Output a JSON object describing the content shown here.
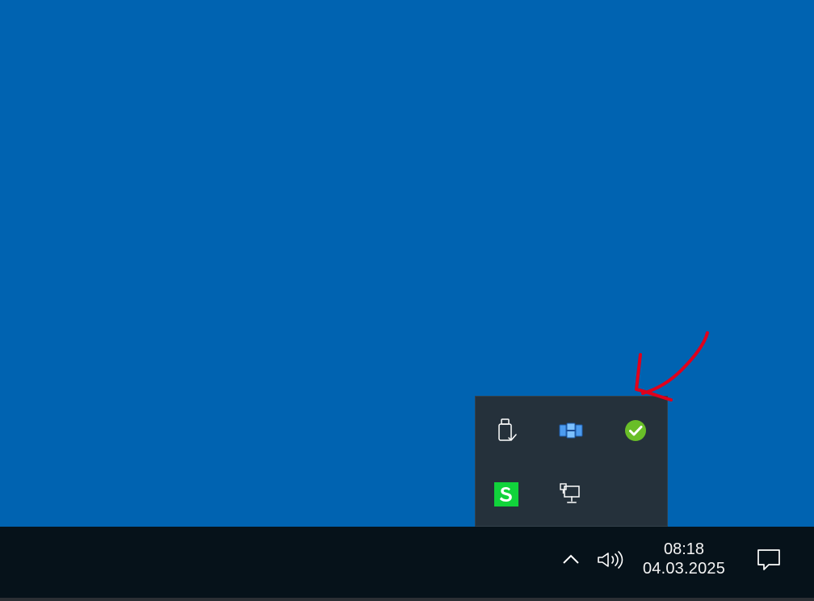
{
  "desktop": {
    "background_color": "#0063B1"
  },
  "system_tray": {
    "overflow_icons": [
      {
        "name": "usb-safely-remove-icon"
      },
      {
        "name": "network-app-icon"
      },
      {
        "name": "status-check-icon"
      },
      {
        "name": "green-s-app-icon"
      },
      {
        "name": "network-computer-icon"
      }
    ],
    "chevron_icon": "chevron-up-icon",
    "volume_icon": "volume-icon"
  },
  "clock": {
    "time": "08:18",
    "date": "04.03.2025"
  },
  "notifications": {
    "icon": "notification-center-icon"
  },
  "annotation": {
    "arrow_color": "#E0001B"
  },
  "colors": {
    "taskbar": "#06121A",
    "tray_popup": "#25313B",
    "text": "#F4F4F4",
    "accent_green": "#69BE28"
  }
}
